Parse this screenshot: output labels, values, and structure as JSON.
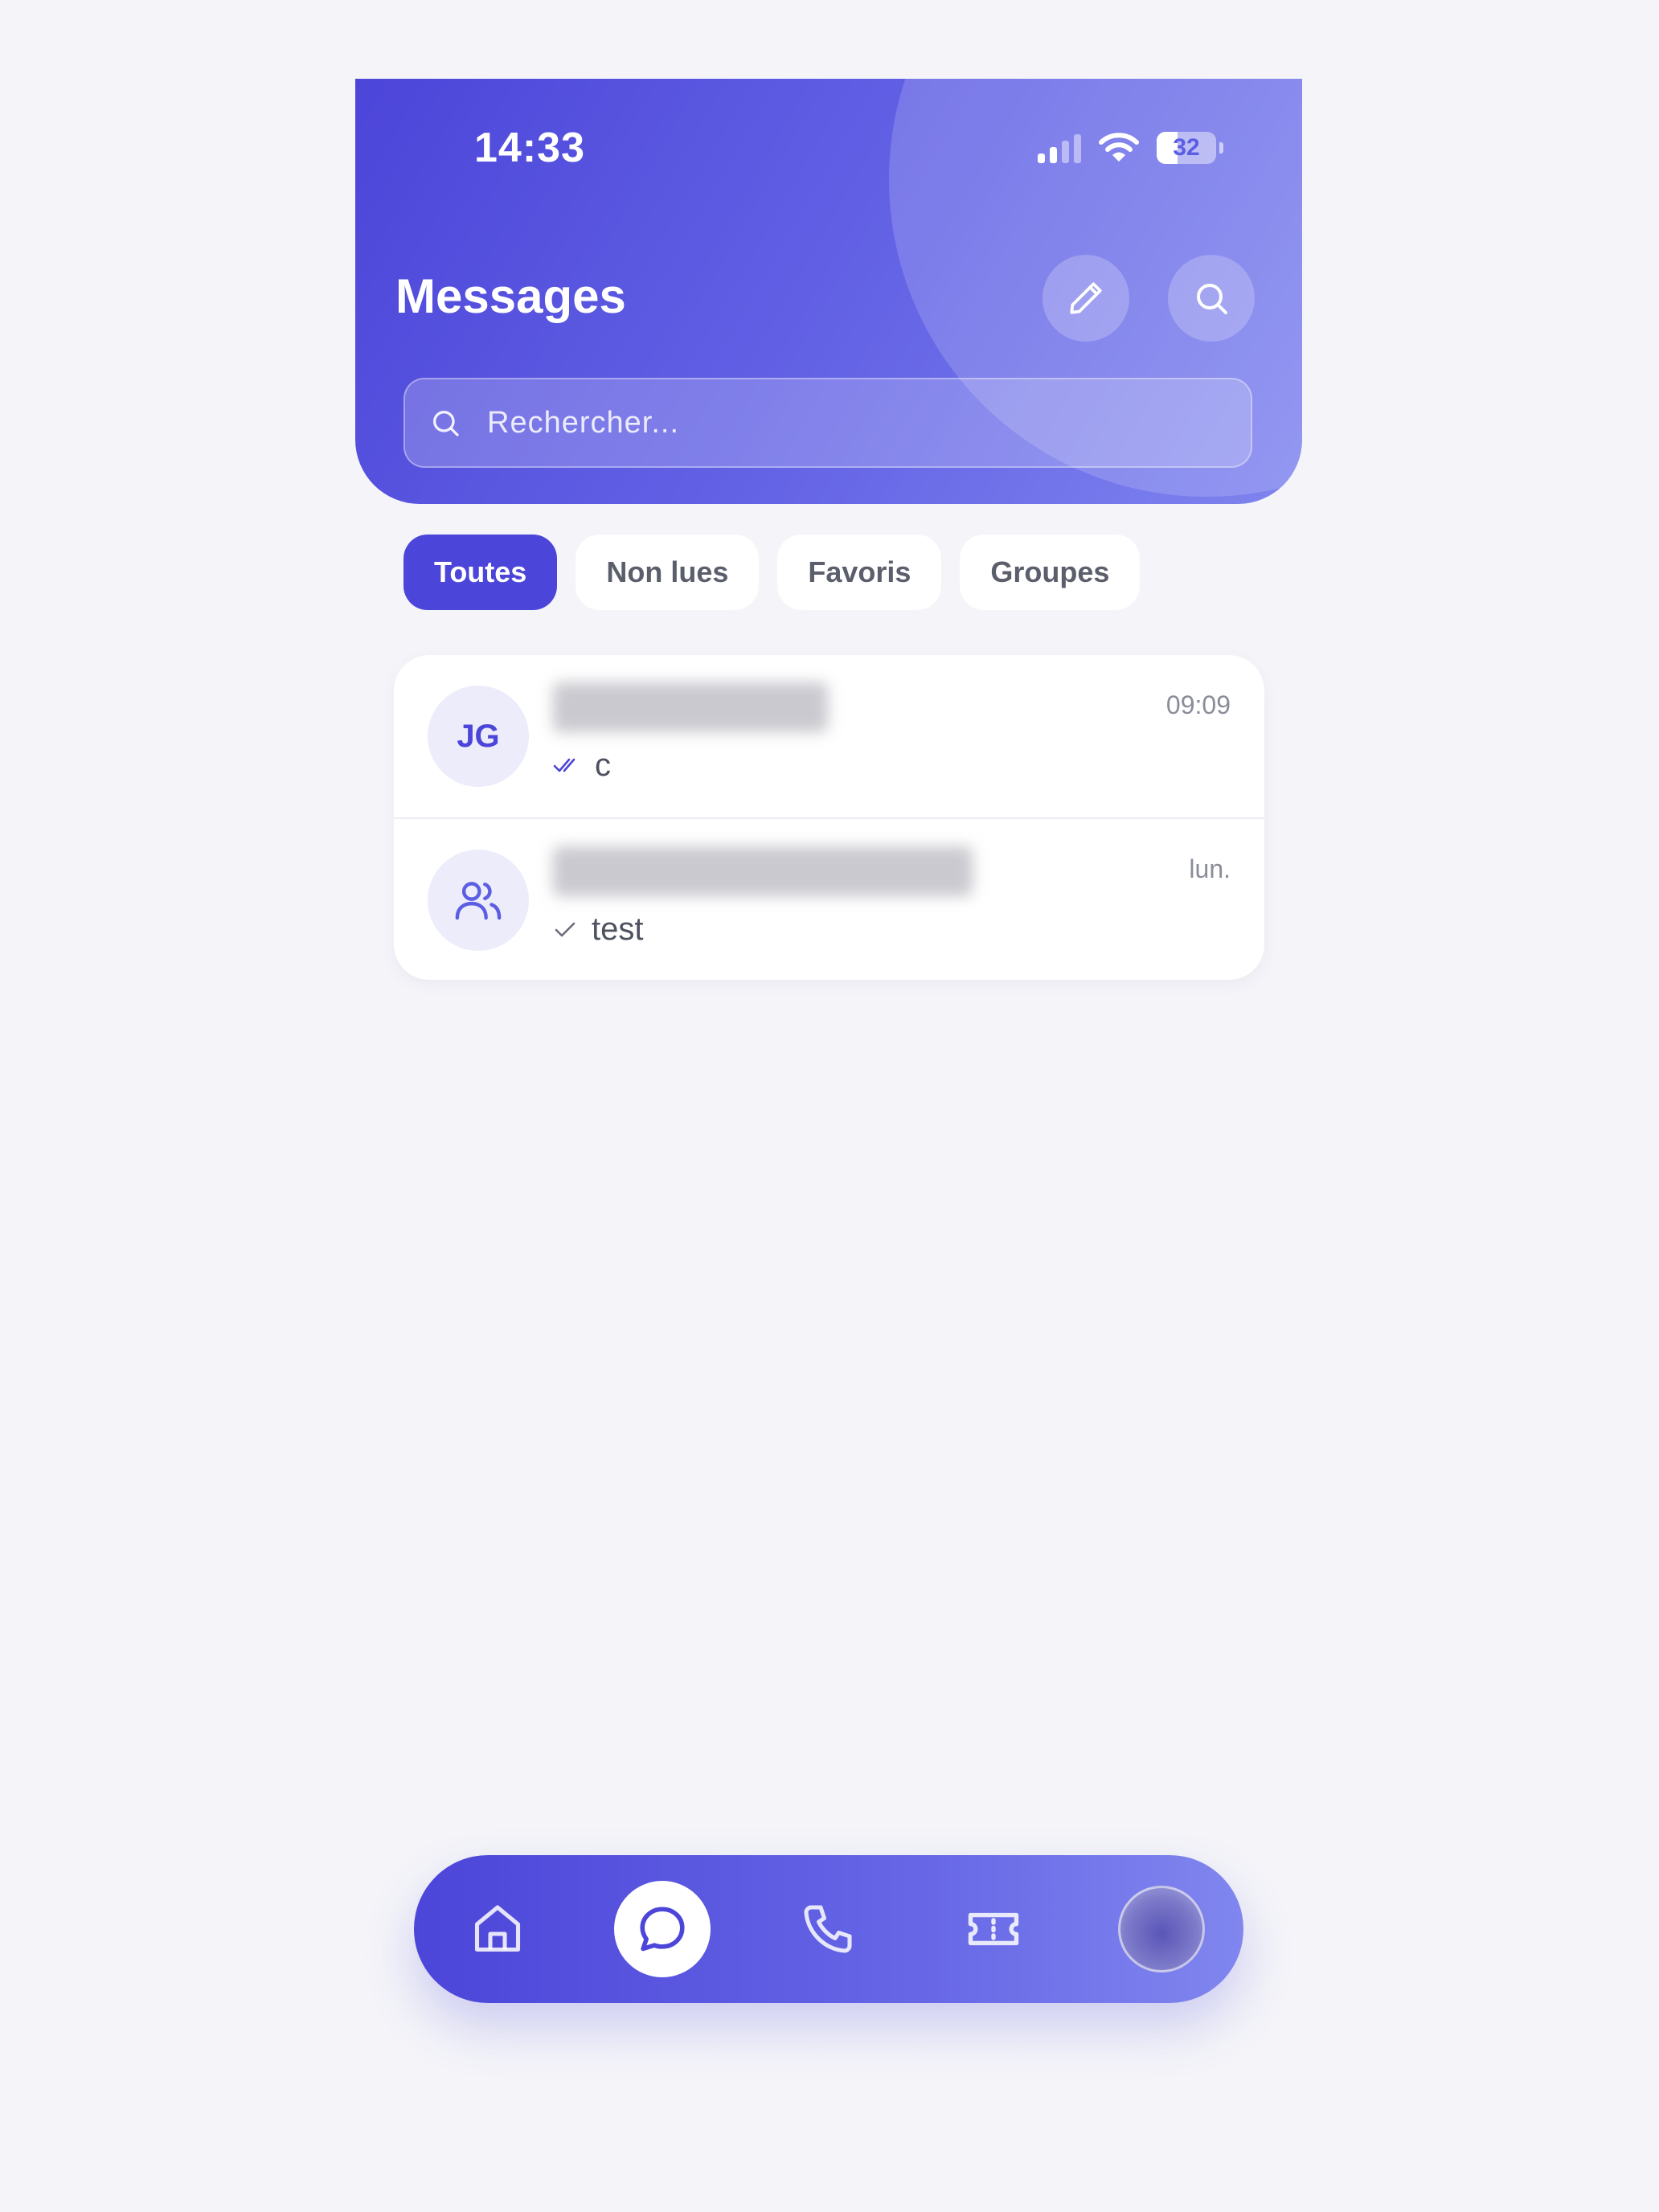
{
  "status_bar": {
    "time": "14:33",
    "battery": "32"
  },
  "header": {
    "title": "Messages"
  },
  "search": {
    "placeholder": "Rechercher..."
  },
  "filters": [
    {
      "label": "Toutes",
      "active": true
    },
    {
      "label": "Non lues",
      "active": false
    },
    {
      "label": "Favoris",
      "active": false
    },
    {
      "label": "Groupes",
      "active": false
    }
  ],
  "conversations": [
    {
      "initials": "JG",
      "avatar": "initials",
      "time": "09:09",
      "status_icon": "double-check-icon",
      "preview": "c"
    },
    {
      "initials": "",
      "avatar": "users-icon",
      "time": "lun.",
      "status_icon": "check-icon",
      "preview": "test"
    }
  ],
  "tabbar": {
    "items": [
      "home-icon",
      "chat-icon",
      "phone-icon",
      "ticket-icon",
      "profile-avatar"
    ],
    "active": "chat-icon"
  },
  "colors": {
    "primary": "#4c45d9",
    "background": "#f4f4f9"
  }
}
